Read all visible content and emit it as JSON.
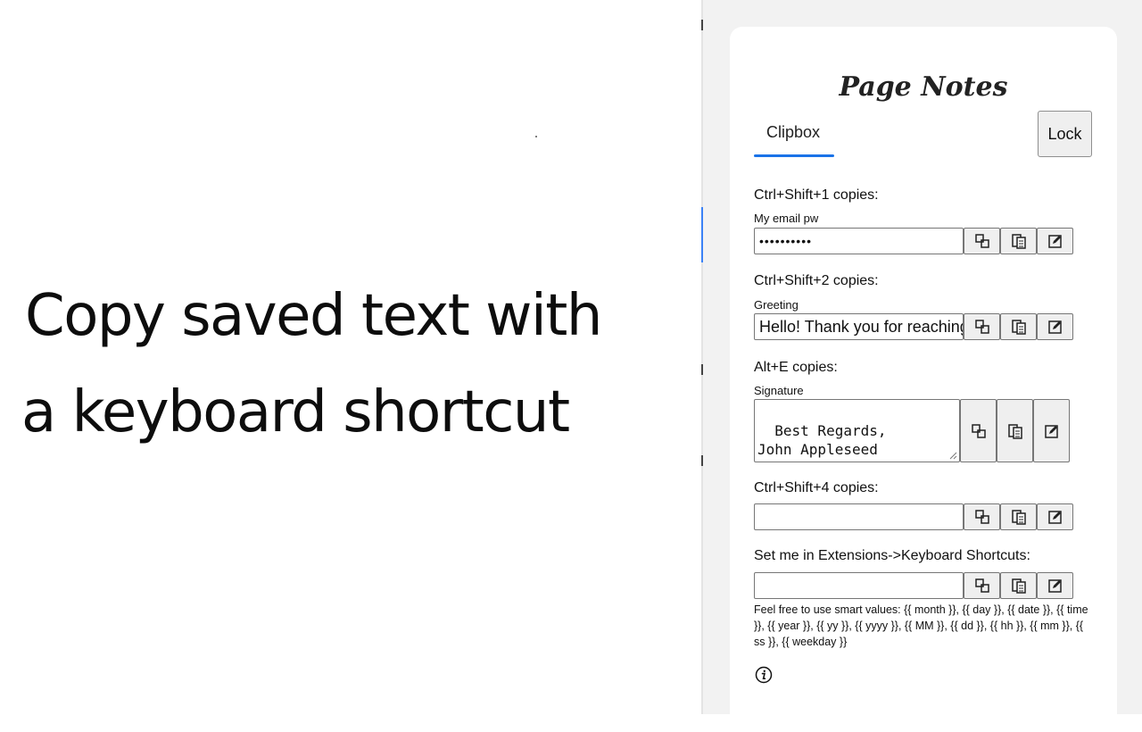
{
  "headline": {
    "line1": "Copy saved text with",
    "line2": "a keyboard shortcut"
  },
  "extension": {
    "logo": "Page Notes",
    "tab_label": "Clipbox",
    "lock_label": "Lock",
    "accent_color": "#1a73e8",
    "slots": [
      {
        "shortcut": "Ctrl+Shift+1 copies:",
        "name": "My email pw",
        "value": "••••••••••",
        "type": "password"
      },
      {
        "shortcut": "Ctrl+Shift+2 copies:",
        "name": "Greeting",
        "value": "Hello! Thank you for reaching out",
        "type": "text"
      },
      {
        "shortcut": "Alt+E copies:",
        "name": "Signature",
        "value": "Best Regards,\nJohn Appleseed",
        "type": "textarea"
      },
      {
        "shortcut": "Ctrl+Shift+4 copies:",
        "name": "",
        "value": "",
        "type": "text"
      },
      {
        "shortcut": "Set me in Extensions->Keyboard Shortcuts:",
        "name": "",
        "value": "",
        "type": "text"
      }
    ],
    "button_icons": [
      "copy-icon",
      "paste-icon",
      "edit-icon"
    ],
    "smart_values_text": "Feel free to use smart values: {{ month }}, {{ day }}, {{ date }}, {{ time }}, {{ year }}, {{ yy }}, {{ yyyy }}, {{ MM }}, {{ dd }}, {{ hh }}, {{ mm }}, {{ ss }}, {{ weekday }}",
    "info_icon": "info-icon"
  }
}
